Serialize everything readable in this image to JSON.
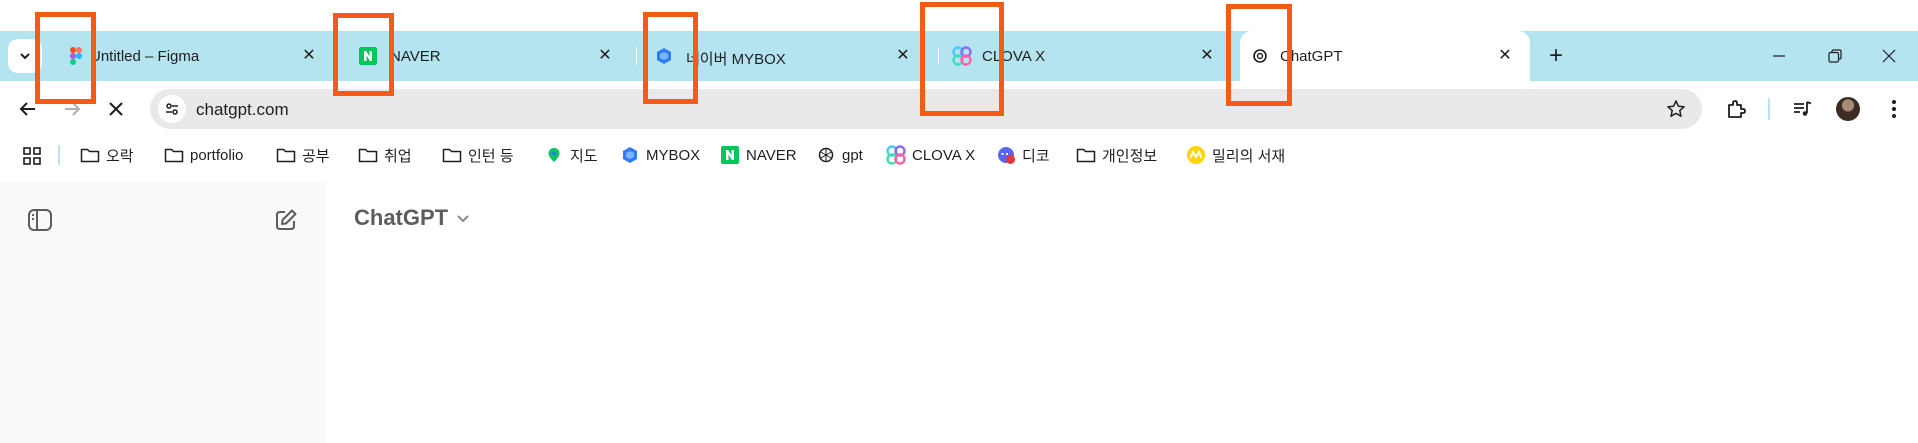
{
  "tabs": [
    {
      "title": "Untitled – Figma",
      "icon": "figma-icon",
      "active": false
    },
    {
      "title": "NAVER",
      "icon": "naver-icon",
      "active": false
    },
    {
      "title": "네이버 MYBOX",
      "icon": "mybox-icon",
      "active": false
    },
    {
      "title": "CLOVA X",
      "icon": "clova-x-icon",
      "active": false
    },
    {
      "title": "ChatGPT",
      "icon": "chatgpt-icon",
      "active": true
    }
  ],
  "address_bar": {
    "url": "chatgpt.com"
  },
  "bookmarks": [
    {
      "label": "오락",
      "icon": "folder-icon"
    },
    {
      "label": "portfolio",
      "icon": "folder-icon"
    },
    {
      "label": "공부",
      "icon": "folder-icon"
    },
    {
      "label": "취업",
      "icon": "folder-icon"
    },
    {
      "label": "인턴 등",
      "icon": "folder-icon"
    },
    {
      "label": "지도",
      "icon": "naver-map-icon"
    },
    {
      "label": "MYBOX",
      "icon": "mybox-icon"
    },
    {
      "label": "NAVER",
      "icon": "naver-icon"
    },
    {
      "label": "gpt",
      "icon": "openai-icon"
    },
    {
      "label": "CLOVA X",
      "icon": "clova-x-icon"
    },
    {
      "label": "디코",
      "icon": "discord-icon"
    },
    {
      "label": "개인정보",
      "icon": "folder-icon"
    },
    {
      "label": "밀리의 서재",
      "icon": "millie-icon"
    }
  ],
  "page": {
    "model_selector": "ChatGPT"
  },
  "colors": {
    "tab_strip": "#b4e4f0",
    "highlight": "#f45b14",
    "sidebar": "#f9f9f9"
  }
}
